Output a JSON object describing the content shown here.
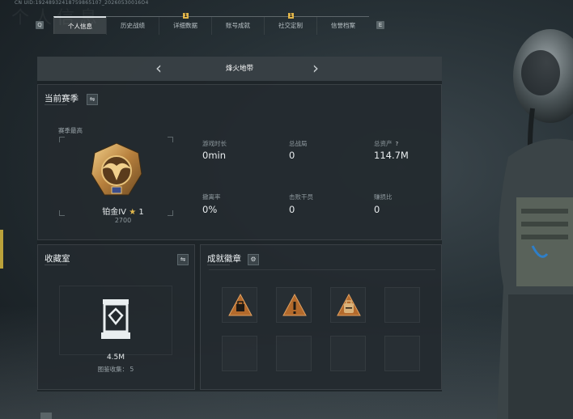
{
  "header": {
    "uid_text": "CN UID:19248932418759865107_20260530016O4",
    "ghost_title": "个人信息"
  },
  "tabs": {
    "left_key": "Q",
    "right_key": "E",
    "items": [
      {
        "label": "个人信息",
        "active": true,
        "notice": ""
      },
      {
        "label": "历史战绩",
        "active": false,
        "notice": ""
      },
      {
        "label": "详细数据",
        "active": false,
        "notice": "1"
      },
      {
        "label": "账号成就",
        "active": false,
        "notice": ""
      },
      {
        "label": "社交定制",
        "active": false,
        "notice": "1"
      },
      {
        "label": "信誉档案",
        "active": false,
        "notice": ""
      }
    ]
  },
  "map_selector": {
    "name": "烽火地带",
    "prev_icon": "chevron-left-icon",
    "next_icon": "chevron-right-icon"
  },
  "season": {
    "title": "当前赛季",
    "switch_icon": "swap-icon",
    "best_label": "赛季最高",
    "rank_name": "铂金IV",
    "rank_star_icon": "star-icon",
    "rank_stars": "1",
    "rank_score": "2700",
    "stats": [
      {
        "label": "游戏时长",
        "value": "0min"
      },
      {
        "label": "总战局",
        "value": "0"
      },
      {
        "label": "总资产",
        "value": "114.7M",
        "help": "?"
      },
      {
        "label": "撤离率",
        "value": "0%"
      },
      {
        "label": "击败干员",
        "value": "0"
      },
      {
        "label": "赚损比",
        "value": "0"
      }
    ]
  },
  "vault": {
    "title": "收藏室",
    "switch_icon": "swap-icon",
    "value": "4.5M",
    "count_label": "图鉴收集：",
    "count": "5"
  },
  "badges": {
    "title": "成就徽章",
    "settings_icon": "gear-icon",
    "items": [
      "badge-bag-icon",
      "badge-exclamation-icon",
      "badge-backpack-icon",
      "",
      "",
      "",
      "",
      ""
    ]
  },
  "colors": {
    "accent_gold": "#e2b84c",
    "badge_bronze": "#b36a2c",
    "panel_bg": "#1c2226"
  }
}
